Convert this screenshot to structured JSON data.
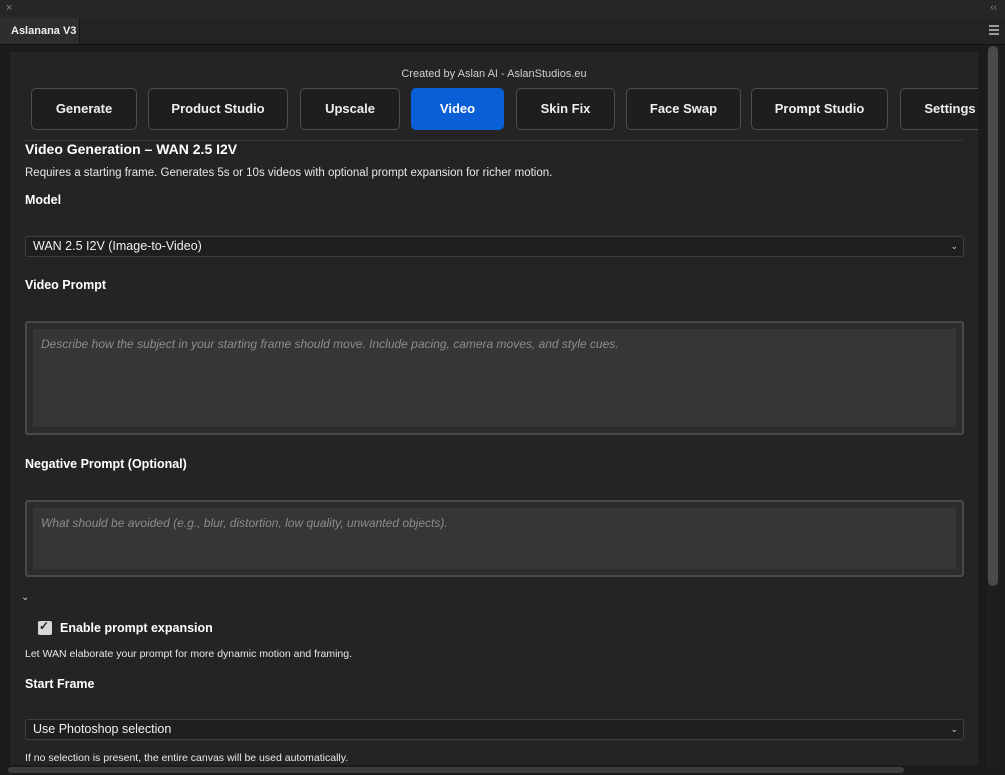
{
  "window": {
    "close_glyph": "×",
    "collapse_glyph": "‹‹"
  },
  "panel": {
    "tab_title": "Aslanana V3"
  },
  "credit": "Created by Aslan AI - AslanStudios.eu",
  "tabs": [
    {
      "label": "Generate",
      "active": false
    },
    {
      "label": "Product Studio",
      "active": false
    },
    {
      "label": "Upscale",
      "active": false
    },
    {
      "label": "Video",
      "active": true
    },
    {
      "label": "Skin Fix",
      "active": false
    },
    {
      "label": "Face Swap",
      "active": false
    },
    {
      "label": "Prompt Studio",
      "active": false
    },
    {
      "label": "Settings",
      "active": false
    }
  ],
  "section": {
    "title": "Video Generation – WAN 2.5 I2V",
    "description": "Requires a starting frame. Generates 5s or 10s videos with optional prompt expansion for richer motion."
  },
  "model": {
    "label": "Model",
    "selected": "WAN 2.5 I2V (Image-to-Video)"
  },
  "video_prompt": {
    "label": "Video Prompt",
    "value": "",
    "placeholder": "Describe how the subject in your starting frame should move. Include pacing, camera moves, and style cues."
  },
  "negative_prompt": {
    "label": "Negative Prompt (Optional)",
    "value": "",
    "placeholder": "What should be avoided (e.g., blur, distortion, low quality, unwanted objects)."
  },
  "prompt_expansion": {
    "label": "Enable prompt expansion",
    "checked": true,
    "help": "Let WAN elaborate your prompt for more dynamic motion and framing."
  },
  "start_frame": {
    "label": "Start Frame",
    "selected": "Use Photoshop selection",
    "help": "If no selection is present, the entire canvas will be used automatically."
  },
  "colors": {
    "accent": "#0b5fd6",
    "background": "#242424"
  }
}
